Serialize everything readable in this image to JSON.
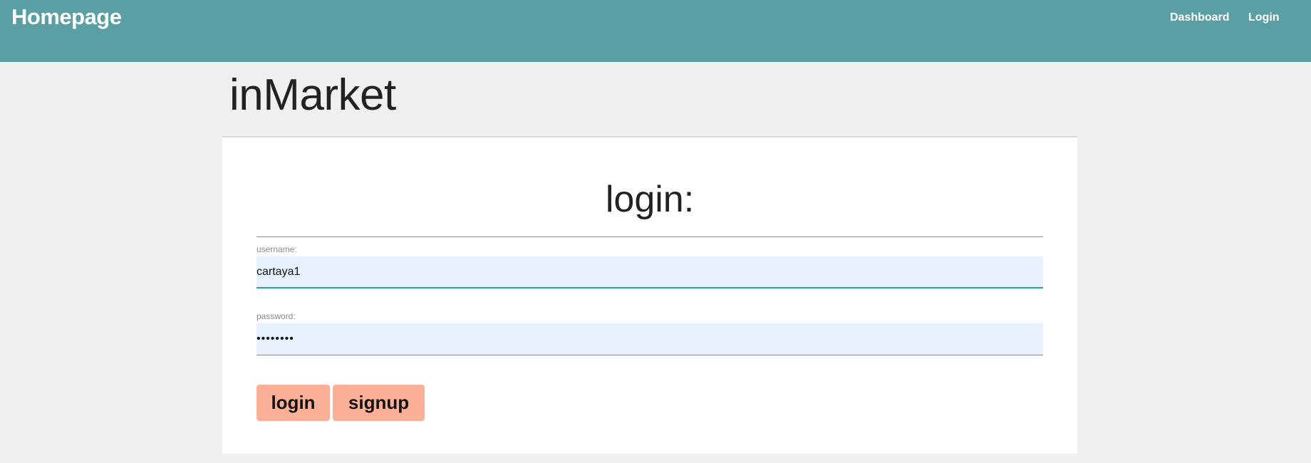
{
  "header": {
    "brand": "Homepage",
    "nav": [
      {
        "label": "Dashboard"
      },
      {
        "label": "Login"
      }
    ]
  },
  "page": {
    "title": "inMarket"
  },
  "login_form": {
    "heading": "login:",
    "username": {
      "label": "username:",
      "value": "cartaya1"
    },
    "password": {
      "label": "password:",
      "value": "••••••••"
    },
    "buttons": {
      "login": "login",
      "signup": "signup"
    }
  },
  "colors": {
    "header_bg": "#5a9fa4",
    "button_bg": "#fcb097",
    "input_bg": "#e7f0fd",
    "focus_underline": "#26a69a"
  }
}
